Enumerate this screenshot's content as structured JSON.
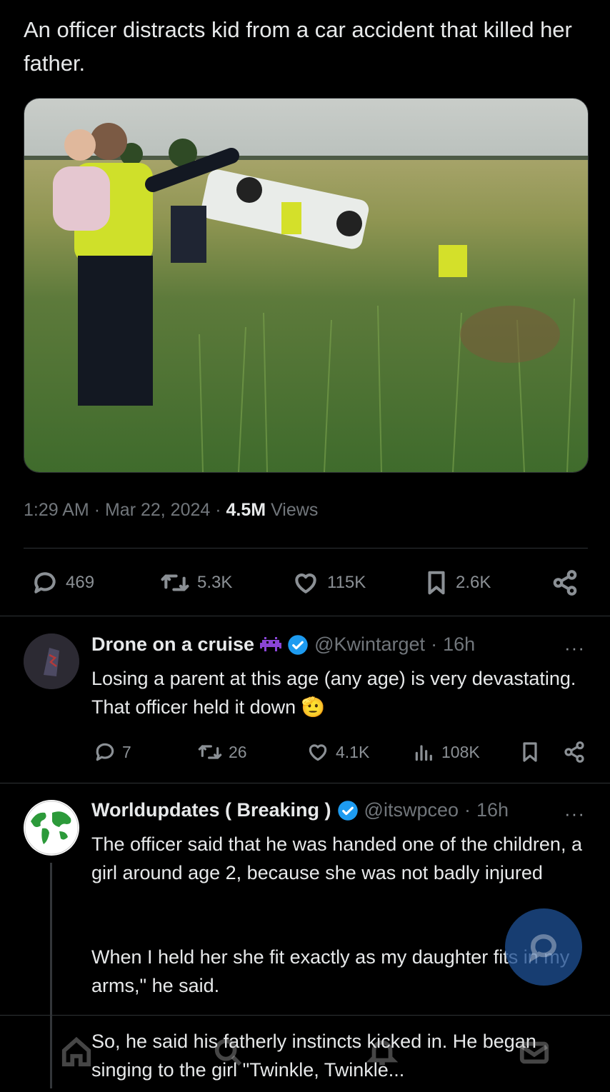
{
  "post": {
    "text": "An officer distracts kid from a car accident that killed her father.",
    "time": "1:29 AM",
    "date": "Mar 22, 2024",
    "views_count": "4.5M",
    "views_label": "Views",
    "replies": "469",
    "reposts": "5.3K",
    "likes": "115K",
    "bookmarks": "2.6K"
  },
  "replies": [
    {
      "name": "Drone on a cruise",
      "handle": "@Kwintarget",
      "age": "16h",
      "text": "Losing a parent at this age (any age) is very devastating. That officer held it down",
      "emoji": "🫡",
      "replies": "7",
      "reposts": "26",
      "likes": "4.1K",
      "views": "108K"
    },
    {
      "name": "Worldupdates ( Breaking )",
      "handle": "@itswpceo",
      "age": "16h",
      "paragraphs": [
        "The officer said that he was handed one of the children, a girl around age 2, because she was not badly injured",
        "When I held her she fit exactly as my daughter fits in my arms,\" he said.",
        "So, he said his fatherly instincts kicked in. He began singing to the girl \"Twinkle, Twinkle..."
      ]
    }
  ],
  "separator": "·",
  "more": "···",
  "colors": {
    "background": "#000000",
    "text": "#e7e9ea",
    "muted": "#71767b",
    "verified": "#1d9bf0",
    "fab": "#1d4e91"
  }
}
